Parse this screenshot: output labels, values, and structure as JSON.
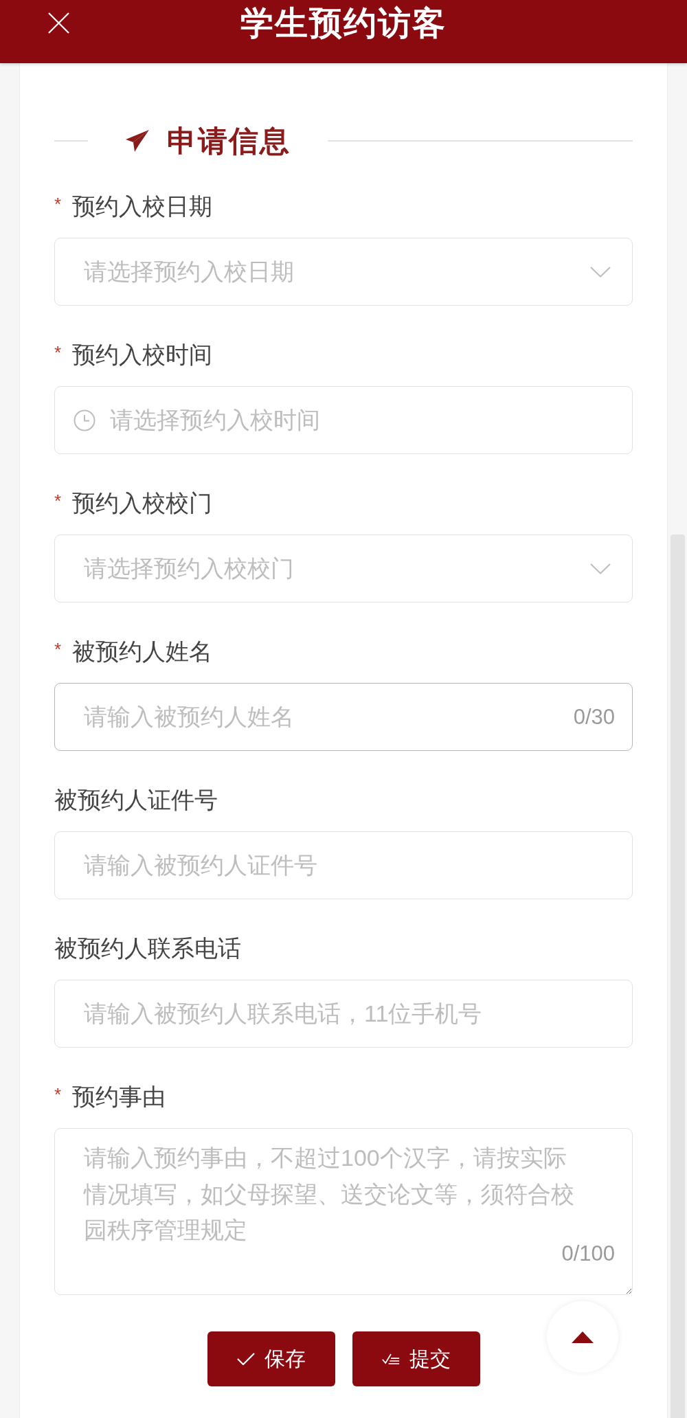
{
  "header": {
    "title": "学生预约访客"
  },
  "section": {
    "title": "申请信息"
  },
  "fields": [
    {
      "kind": "select",
      "required_mark": "*",
      "label": "预约入校日期",
      "placeholder": "请选择预约入校日期",
      "focused": false
    },
    {
      "kind": "time",
      "required_mark": "*",
      "label": "预约入校时间",
      "placeholder": "请选择预约入校时间",
      "focused": false
    },
    {
      "kind": "select",
      "required_mark": "*",
      "label": "预约入校校门",
      "placeholder": "请选择预约入校校门",
      "focused": false
    },
    {
      "kind": "text",
      "required_mark": "*",
      "label": "被预约人姓名",
      "placeholder": "请输入被预约人姓名",
      "counter": "0/30",
      "focused": true
    },
    {
      "kind": "text",
      "label": "被预约人证件号",
      "placeholder": "请输入被预约人证件号",
      "focused": false
    },
    {
      "kind": "text",
      "label": "被预约人联系电话",
      "placeholder": "请输入被预约人联系电话，11位手机号",
      "focused": false
    },
    {
      "kind": "textarea",
      "required_mark": "*",
      "label": "预约事由",
      "placeholder": "请输入预约事由，不超过100个汉字，请按实际情况填写，如父母探望、送交论文等，须符合校园秩序管理规定",
      "counter": "0/100",
      "focused": false
    }
  ],
  "buttons": [
    {
      "kind": "save",
      "label": "保存"
    },
    {
      "kind": "submit",
      "label": "提交"
    }
  ]
}
